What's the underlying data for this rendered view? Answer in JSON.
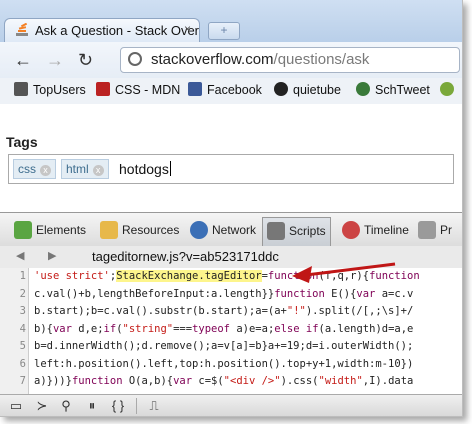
{
  "browser": {
    "tab_title": "Ask a Question - Stack Over",
    "tab_close": "×",
    "newtab_label": "+",
    "nav": {
      "back": "←",
      "forward": "→",
      "reload": "↻"
    },
    "url_host": "stackoverflow.com",
    "url_path": "/questions/ask"
  },
  "bookmarks": [
    {
      "label": "TopUsers",
      "color": "#444"
    },
    {
      "label": "CSS - MDN",
      "color": "#b22"
    },
    {
      "label": "Facebook",
      "color": "#3b5998"
    },
    {
      "label": "quietube",
      "color": "#222"
    },
    {
      "label": "SchTweet",
      "color": "#3a7a3a"
    }
  ],
  "page": {
    "tags_label": "Tags",
    "tags": [
      "css",
      "html"
    ],
    "typed_value": "hotdogs"
  },
  "devtools": {
    "tabs": [
      "Elements",
      "Resources",
      "Network",
      "Scripts",
      "Timeline",
      "Pr"
    ],
    "active_tab": "Scripts",
    "file": "tageditornew.js?v=ab523171ddc",
    "lines": [
      {
        "no": "1",
        "parts": [
          [
            "str",
            "'use strict'"
          ],
          [
            "txt",
            ";"
          ],
          [
            "hl",
            "StackExchange.tagEditor"
          ],
          [
            "txt",
            "="
          ],
          [
            "kw",
            "function"
          ],
          [
            "txt",
            "(f,q,r){"
          ],
          [
            "kw",
            "function"
          ]
        ]
      },
      {
        "no": "2",
        "parts": [
          [
            "txt",
            "c.val()+b,lengthBeforeInput:a.length}}"
          ],
          [
            "kw",
            "function"
          ],
          [
            "txt",
            " E(){"
          ],
          [
            "kw",
            "var"
          ],
          [
            "txt",
            " a=c.v"
          ]
        ]
      },
      {
        "no": "3",
        "parts": [
          [
            "txt",
            "b.start);b=c.val().substr(b.start);a=(a+"
          ],
          [
            "str",
            "\"!\""
          ],
          [
            "txt",
            ").split(/[,;\\s]+/"
          ]
        ]
      },
      {
        "no": "4",
        "parts": [
          [
            "txt",
            "b){"
          ],
          [
            "kw",
            "var"
          ],
          [
            "txt",
            " d,e;"
          ],
          [
            "kw",
            "if"
          ],
          [
            "txt",
            "("
          ],
          [
            "str",
            "\"string\""
          ],
          [
            "txt",
            "==="
          ],
          [
            "kw",
            "typeof"
          ],
          [
            "txt",
            " a)e=a;"
          ],
          [
            "kw",
            "else if"
          ],
          [
            "txt",
            "(a.length)d=a,e"
          ]
        ]
      },
      {
        "no": "5",
        "parts": [
          [
            "txt",
            "b=d.innerWidth();d.remove();a=v[a]=b}a+=19;d=i.outerWidth();"
          ]
        ]
      },
      {
        "no": "6",
        "parts": [
          [
            "txt",
            "left:h.position().left,top:h.position().top+y+1,width:m-10})"
          ]
        ]
      },
      {
        "no": "7",
        "parts": [
          [
            "txt",
            "a)}))}"
          ],
          [
            "kw",
            "function"
          ],
          [
            "txt",
            " O(a,b){"
          ],
          [
            "kw",
            "var"
          ],
          [
            "txt",
            " c=$("
          ],
          [
            "str",
            "\"<div />\""
          ],
          [
            "txt",
            ").css("
          ],
          [
            "str",
            "\"width\""
          ],
          [
            "txt",
            ",I).data"
          ]
        ]
      }
    ],
    "status_icons": [
      "dock-icon",
      "console-icon",
      "search-icon",
      "pause-icon",
      "pretty-print-icon",
      "elements-icon"
    ]
  }
}
